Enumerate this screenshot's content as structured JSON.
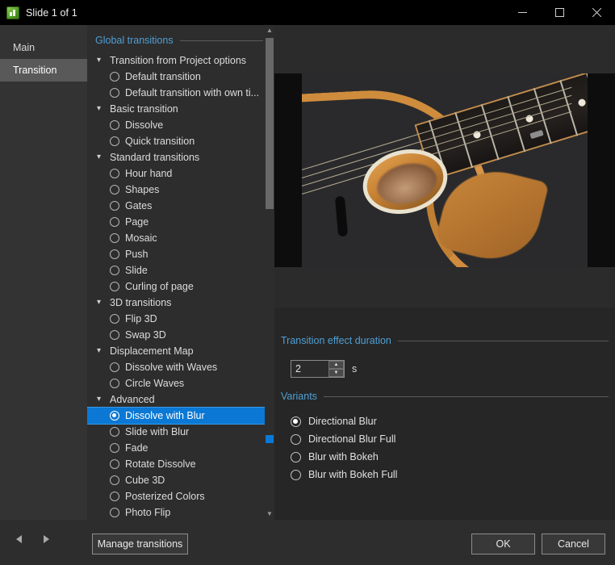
{
  "window": {
    "title": "Slide 1 of 1",
    "app_icon": "chart-app-icon",
    "minimize_label": "Minimize",
    "maximize_label": "Maximize",
    "close_label": "Close"
  },
  "tabs": [
    {
      "label": "Main",
      "active": false
    },
    {
      "label": "Transition",
      "active": true
    }
  ],
  "transition_list": {
    "header": "Global transitions",
    "accent_color": "#4f9fd4",
    "selection_color": "#0a78d4",
    "rows": [
      {
        "type": "group",
        "label": "Transition from Project options",
        "expanded": true
      },
      {
        "type": "item",
        "label": "Default transition",
        "selected": false
      },
      {
        "type": "item",
        "label": "Default transition with own ti...",
        "selected": false
      },
      {
        "type": "group",
        "label": "Basic transition",
        "expanded": true
      },
      {
        "type": "item",
        "label": "Dissolve",
        "selected": false
      },
      {
        "type": "item",
        "label": "Quick transition",
        "selected": false
      },
      {
        "type": "group",
        "label": "Standard transitions",
        "expanded": true
      },
      {
        "type": "item",
        "label": "Hour hand",
        "selected": false
      },
      {
        "type": "item",
        "label": "Shapes",
        "selected": false
      },
      {
        "type": "item",
        "label": "Gates",
        "selected": false
      },
      {
        "type": "item",
        "label": "Page",
        "selected": false
      },
      {
        "type": "item",
        "label": "Mosaic",
        "selected": false
      },
      {
        "type": "item",
        "label": "Push",
        "selected": false
      },
      {
        "type": "item",
        "label": "Slide",
        "selected": false
      },
      {
        "type": "item",
        "label": "Curling of page",
        "selected": false
      },
      {
        "type": "group",
        "label": "3D transitions",
        "expanded": true
      },
      {
        "type": "item",
        "label": "Flip 3D",
        "selected": false
      },
      {
        "type": "item",
        "label": "Swap 3D",
        "selected": false
      },
      {
        "type": "group",
        "label": "Displacement Map",
        "expanded": true
      },
      {
        "type": "item",
        "label": "Dissolve with Waves",
        "selected": false
      },
      {
        "type": "item",
        "label": "Circle Waves",
        "selected": false
      },
      {
        "type": "group",
        "label": "Advanced",
        "expanded": true
      },
      {
        "type": "item",
        "label": "Dissolve with Blur",
        "selected": true
      },
      {
        "type": "item",
        "label": "Slide with Blur",
        "selected": false
      },
      {
        "type": "item",
        "label": "Fade",
        "selected": false
      },
      {
        "type": "item",
        "label": "Rotate Dissolve",
        "selected": false
      },
      {
        "type": "item",
        "label": "Cube 3D",
        "selected": false
      },
      {
        "type": "item",
        "label": "Posterized Colors",
        "selected": false
      },
      {
        "type": "item",
        "label": "Photo Flip",
        "selected": false
      }
    ],
    "chevron_glyph": "⌄"
  },
  "preview": {
    "alt": "acoustic guitar sound hole close-up",
    "slider_position_percent": 63
  },
  "duration_panel": {
    "header": "Transition effect duration",
    "value": "2",
    "placeholder": "2",
    "unit": "s",
    "increment_label": "▲",
    "decrement_label": "▼"
  },
  "variants_panel": {
    "header": "Variants",
    "options": [
      {
        "label": "Directional Blur",
        "selected": true
      },
      {
        "label": "Directional Blur Full",
        "selected": false
      },
      {
        "label": "Blur with Bokeh",
        "selected": false
      },
      {
        "label": "Blur with Bokeh Full",
        "selected": false
      }
    ]
  },
  "bottom_bar": {
    "prev_label": "Previous slide",
    "next_label": "Next slide",
    "manage_label": "Manage transitions",
    "ok_label": "OK",
    "cancel_label": "Cancel"
  }
}
